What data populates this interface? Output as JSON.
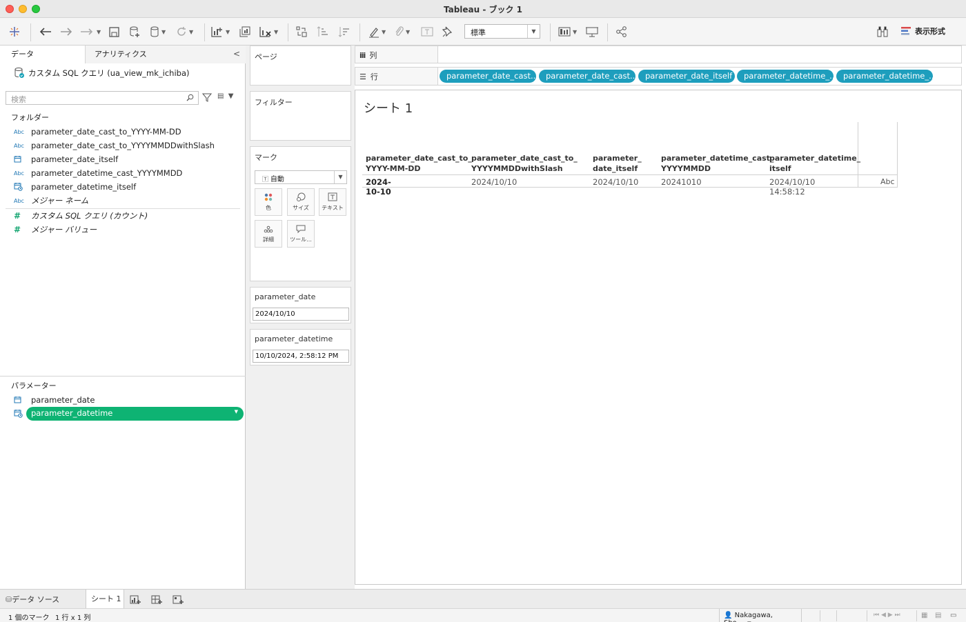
{
  "window": {
    "title": "Tableau - ブック 1"
  },
  "toolbar": {
    "fit_select": "標準",
    "show_me": "表示形式"
  },
  "left_panel": {
    "tab_data": "データ",
    "tab_analytics": "アナリティクス",
    "datasource": "カスタム SQL クエリ (ua_view_mk_ichiba)",
    "search_placeholder": "検索",
    "folders_header": "フォルダー",
    "dimensions": [
      {
        "icon": "Abc",
        "name": "parameter_date_cast_to_YYYY-MM-DD"
      },
      {
        "icon": "Abc",
        "name": "parameter_date_cast_to_YYYYMMDDwithSlash"
      },
      {
        "icon": "calendar-icon",
        "name": "parameter_date_itself"
      },
      {
        "icon": "Abc",
        "name": "parameter_datetime_cast_YYYYMMDD"
      },
      {
        "icon": "datetime-icon",
        "name": "parameter_datetime_itself"
      },
      {
        "icon": "Abc",
        "name": "メジャー ネーム"
      }
    ],
    "measures": [
      {
        "icon": "#",
        "name": "カスタム SQL クエリ (カウント)"
      },
      {
        "icon": "#",
        "name": "メジャー バリュー"
      }
    ],
    "parameters_header": "パラメーター",
    "parameters": [
      {
        "icon": "calendar-icon",
        "name": "parameter_date"
      },
      {
        "icon": "datetime-icon",
        "name": "parameter_datetime"
      }
    ]
  },
  "shelves": {
    "pages": "ページ",
    "filters": "フィルター",
    "marks": "マーク",
    "mark_type": "自動",
    "mark_buttons": [
      "色",
      "サイズ",
      "テキスト",
      "詳細",
      "ツール..."
    ],
    "param_date_label": "parameter_date",
    "param_date_value": "2024/10/10",
    "param_datetime_label": "parameter_datetime",
    "param_datetime_value": "10/10/2024, 2:58:12 PM",
    "columns_label": "列",
    "rows_label": "行",
    "row_pills": [
      "parameter_date_cast..",
      "parameter_date_cast..",
      "parameter_date_itself",
      "parameter_datetime_..",
      "parameter_datetime_.."
    ]
  },
  "view": {
    "sheet_title": "シート 1",
    "headers": [
      [
        "parameter_date_cast_to_",
        "YYYY-MM-DD"
      ],
      [
        "parameter_date_cast_to_",
        "YYYYMMDDwithSlash"
      ],
      [
        "parameter_",
        "date_itself"
      ],
      [
        "parameter_datetime_cast_",
        "YYYYMMDD"
      ],
      [
        "parameter_datetime_",
        "itself"
      ]
    ],
    "row": [
      "2024-10-10",
      "2024/10/10",
      "2024/10/10",
      "20241010",
      "2024/10/10 14:58:12",
      "Abc"
    ]
  },
  "bottom": {
    "datasource_tab": "データ ソース",
    "sheet_tab": "シート 1",
    "status_marks": "1 個のマーク",
    "status_rows": "1 行 x 1 列",
    "user": "Nakagawa, Sho..."
  }
}
